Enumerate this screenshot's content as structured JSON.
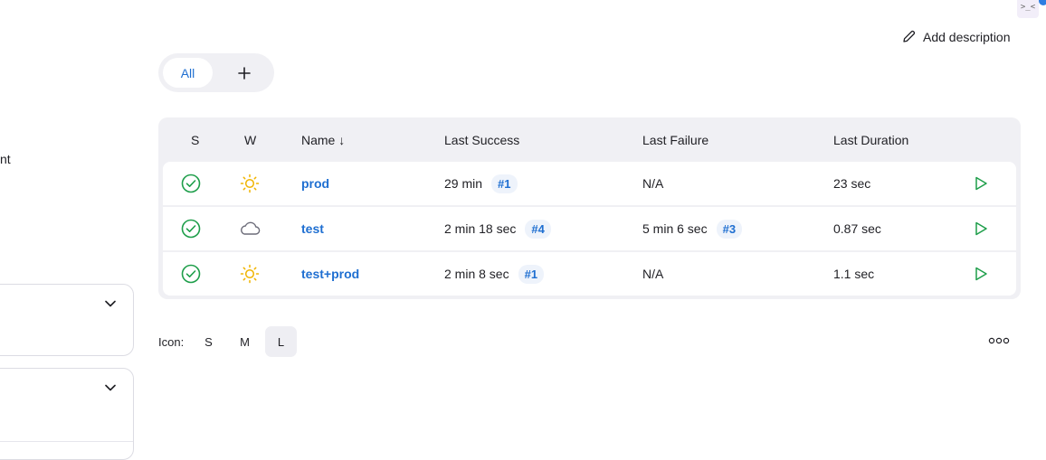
{
  "corner": {
    "glyph": ">_<"
  },
  "sidebar": {
    "partial_text": "nt"
  },
  "header": {
    "add_description": "Add description"
  },
  "views": {
    "tabs": [
      {
        "label": "All",
        "active": true
      }
    ],
    "add_label": "+"
  },
  "table": {
    "columns": {
      "s": "S",
      "w": "W",
      "name": "Name ↓",
      "last_success": "Last Success",
      "last_failure": "Last Failure",
      "last_duration": "Last Duration"
    },
    "rows": [
      {
        "status": "success",
        "weather": "sunny",
        "name": "prod",
        "success_time": "29 min",
        "success_build": "#1",
        "failure_time": "N/A",
        "failure_build": "",
        "duration": "23 sec"
      },
      {
        "status": "success",
        "weather": "cloudy",
        "name": "test",
        "success_time": "2 min 18 sec",
        "success_build": "#4",
        "failure_time": "5 min 6 sec",
        "failure_build": "#3",
        "duration": "0.87 sec"
      },
      {
        "status": "success",
        "weather": "sunny",
        "name": "test+prod",
        "success_time": "2 min 8 sec",
        "success_build": "#1",
        "failure_time": "N/A",
        "failure_build": "",
        "duration": "1.1 sec"
      }
    ]
  },
  "icon_size": {
    "label": "Icon:",
    "options": [
      "S",
      "M",
      "L"
    ],
    "selected": "L"
  },
  "colors": {
    "accent": "#1f6fd1",
    "success": "#1e9e4a",
    "sun": "#f0b400",
    "cloud": "#6b6b78"
  },
  "icons": {
    "status_ok": "check-circle-icon",
    "sunny": "sun-icon",
    "cloudy": "cloud-icon",
    "run": "play-icon",
    "edit": "pencil-icon",
    "more": "ellipsis-icon"
  }
}
